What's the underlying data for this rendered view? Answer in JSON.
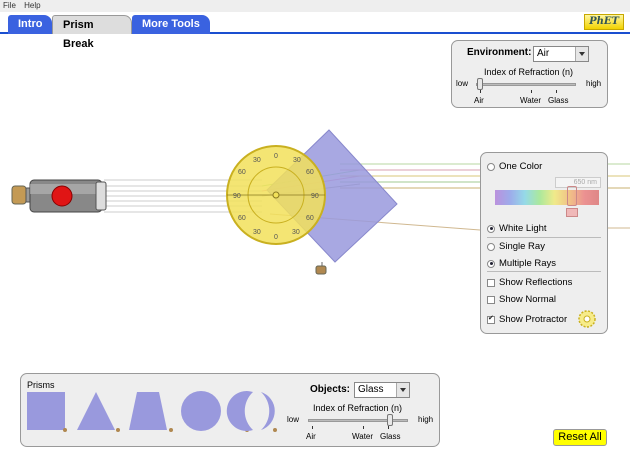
{
  "menu": {
    "file": "File",
    "help": "Help"
  },
  "tabs": [
    {
      "label": "Intro",
      "active": false
    },
    {
      "label": "Prism Break",
      "active": true
    },
    {
      "label": "More Tools",
      "active": false
    }
  ],
  "logo_text": "PhET",
  "environment": {
    "label": "Environment:",
    "value": "Air",
    "index_label": "Index of Refraction (n)",
    "low": "low",
    "high": "high",
    "marks": [
      "Air",
      "Water",
      "Glass"
    ]
  },
  "light": {
    "one_color": "One Color",
    "wavelength": "650",
    "wavelength_unit": "nm",
    "white_light": "White Light",
    "single_ray": "Single Ray",
    "multiple_rays": "Multiple Rays",
    "selected_source": "white_light",
    "selected_rays": "multiple_rays",
    "show_reflections": "Show Reflections",
    "show_normal": "Show Normal",
    "show_protractor": "Show Protractor",
    "reflections_checked": false,
    "normal_checked": false,
    "protractor_checked": true
  },
  "prisms": {
    "title": "Prisms",
    "objects_label": "Objects:",
    "objects_value": "Glass",
    "index_label": "Index of Refraction (n)",
    "low": "low",
    "high": "high",
    "marks": [
      "Air",
      "Water",
      "Glass"
    ]
  },
  "protractor_labels": [
    "0",
    "30",
    "60",
    "90",
    "60",
    "30",
    "0",
    "30",
    "60",
    "90",
    "60",
    "30"
  ],
  "reset_label": "Reset All",
  "colors": {
    "tab_blue": "#3a62e0",
    "prism_fill": "#9999dd",
    "protractor": "#f2e15a",
    "laser_red": "#e01515",
    "reset_yellow": "#ffff00"
  }
}
